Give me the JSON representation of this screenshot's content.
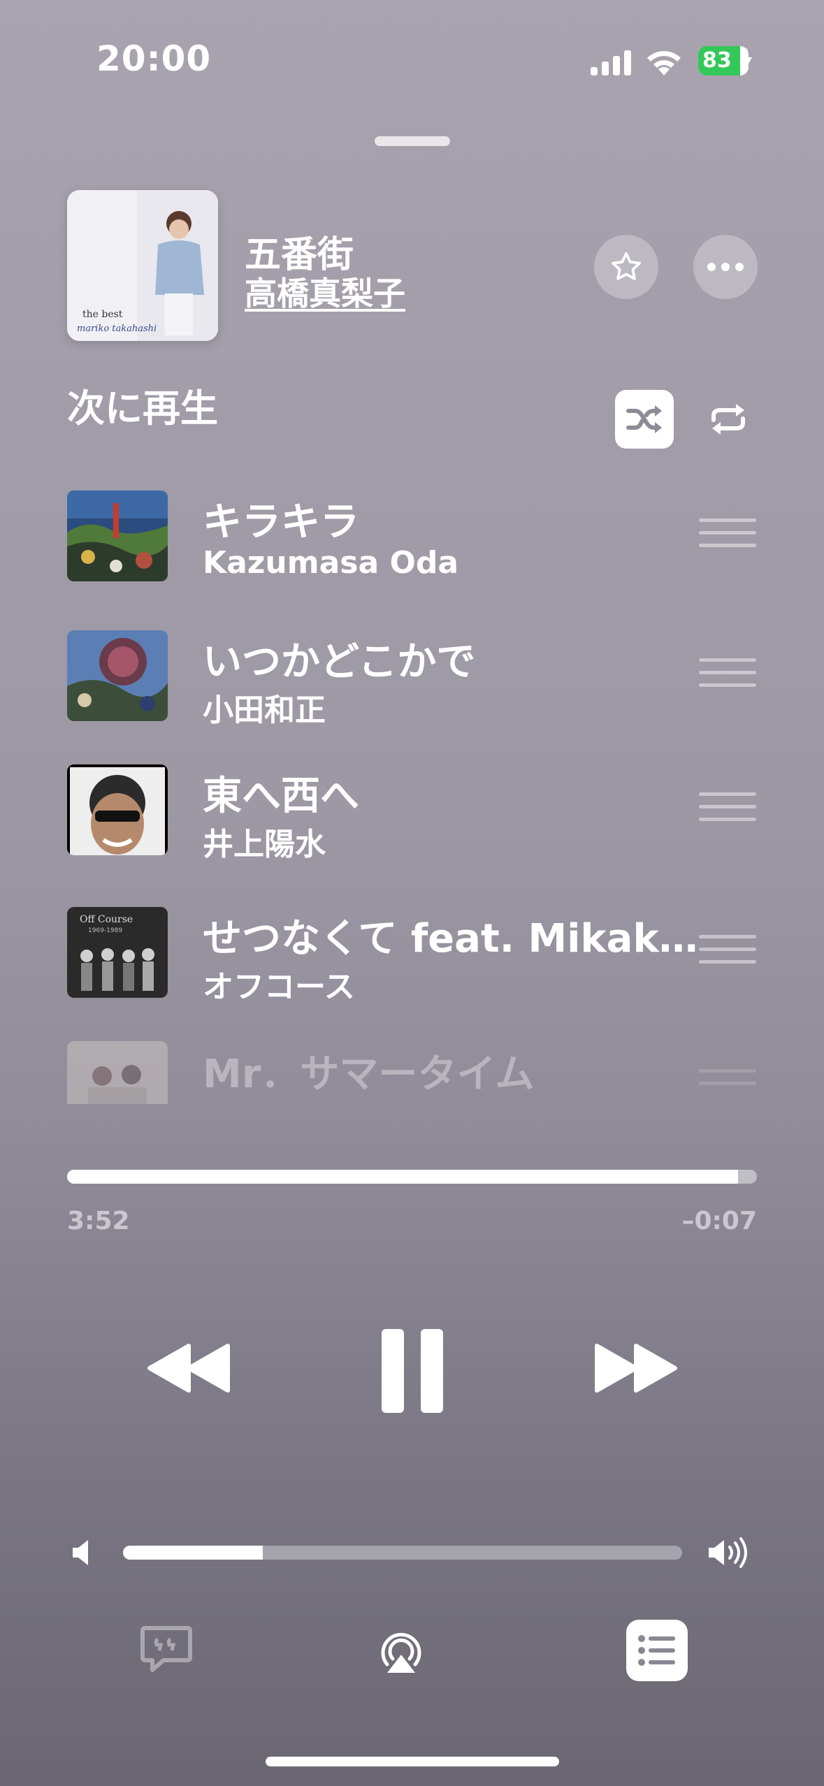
{
  "status": {
    "time": "20:00",
    "battery": "83",
    "battery_level": 0.83
  },
  "now_playing": {
    "title": "五番街",
    "artist": "高橋真梨子"
  },
  "up_next": {
    "heading": "次に再生",
    "items": [
      {
        "title": "キラキラ",
        "artist": "Kazumasa Oda"
      },
      {
        "title": "いつかどこかで",
        "artist": "小田和正"
      },
      {
        "title": "東へ西へ",
        "artist": "井上陽水"
      },
      {
        "title": "せつなくて feat. Mikak…",
        "artist": "オフコース"
      },
      {
        "title": "Mr．サマータイム",
        "artist": ""
      }
    ]
  },
  "playback": {
    "elapsed": "3:52",
    "remaining": "–0:07",
    "progress": 0.973,
    "volume": 0.25
  },
  "colors": {
    "battery_green": "#34c759"
  }
}
